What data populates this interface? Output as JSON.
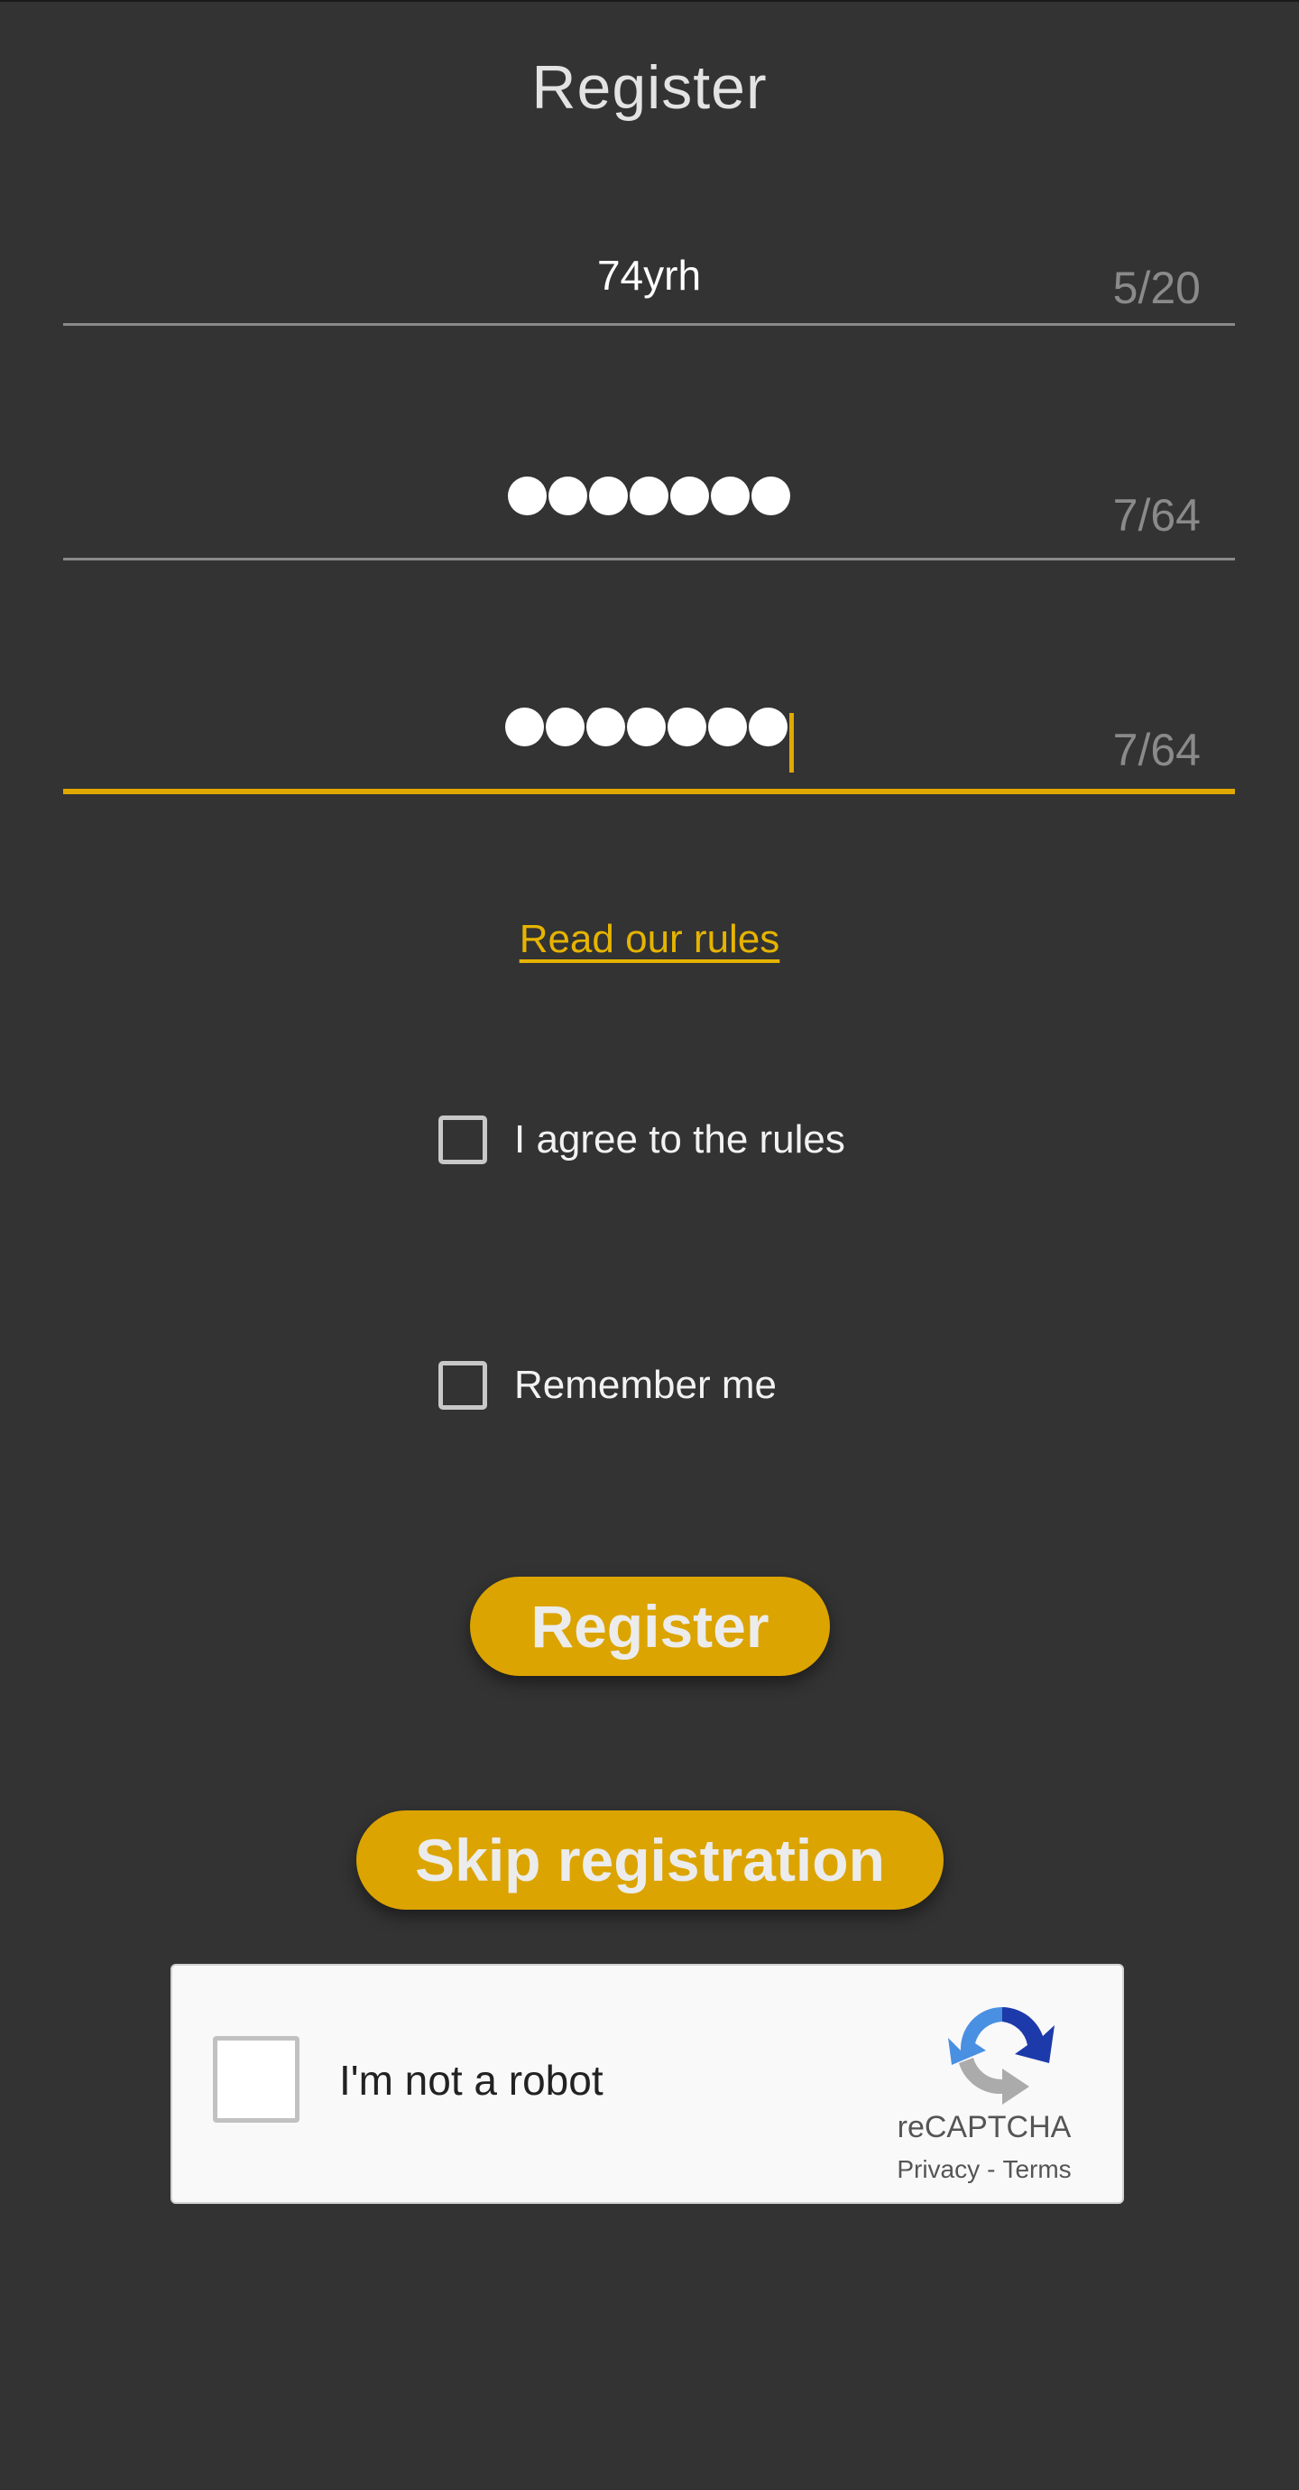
{
  "header": {
    "title": "Register"
  },
  "form": {
    "username": {
      "value": "74yrh",
      "counter": "5/20"
    },
    "password": {
      "masked_length": 7,
      "counter": "7/64"
    },
    "confirm_password": {
      "masked_length": 7,
      "counter": "7/64",
      "focused": true
    },
    "rules_link": "Read our rules",
    "agree_checkbox": {
      "label": "I agree to the rules",
      "checked": false
    },
    "remember_checkbox": {
      "label": "Remember me",
      "checked": false
    },
    "register_button": "Register",
    "skip_button": "Skip registration"
  },
  "recaptcha": {
    "label": "I'm not a robot",
    "brand": "reCAPTCHA",
    "privacy": "Privacy",
    "separator": "-",
    "terms": "Terms",
    "checked": false
  },
  "colors": {
    "background": "#333333",
    "accent": "#dca400",
    "link": "#e6b400",
    "underline_inactive": "#8a8a8a"
  }
}
